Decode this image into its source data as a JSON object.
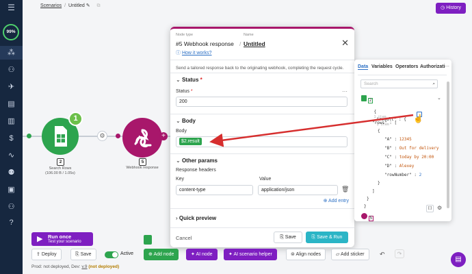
{
  "usage": "99%",
  "breadcrumb": {
    "root": "Scenarios",
    "separator": "/",
    "title": "Untitled"
  },
  "history_label": "History",
  "nodes": {
    "search_rows": {
      "number": "2",
      "label": "Search Rows",
      "sublabel": "(106.00 B / 1.05s)",
      "badge": "1",
      "color": "#2da44e"
    },
    "webhook_response": {
      "number": "5",
      "label": "Webhook response",
      "color": "#a8176b"
    }
  },
  "panel": {
    "node_type_caption": "Node type",
    "node_type": "#5 Webhook response",
    "name_caption": "Name",
    "name": "Untitled",
    "how_link": "How it works?",
    "description": "Send a tailored response back to the originating webhook, completing the request cycle.",
    "status_section": "Status",
    "required_mark": "*",
    "status_label": "Status",
    "status_value": "200",
    "body_section": "Body",
    "body_label": "Body",
    "body_chip": "$2.result",
    "other_params_section": "Other params",
    "response_headers_label": "Response headers",
    "key_header": "Key",
    "value_header": "Value",
    "key_value": "content-type",
    "value_value": "application/json",
    "add_entry": "Add entry",
    "quick_preview_section": "Quick preview",
    "cancel_label": "Cancel",
    "save_label": "Save",
    "save_run_label": "Save & Run"
  },
  "data_panel": {
    "tabs": [
      "Data",
      "Variables",
      "Operators",
      "Authorizati"
    ],
    "search_placeholder": "Search",
    "source_number": "2",
    "items_count": "1 item",
    "items_count_2": "1 item",
    "tree": {
      "open_brace": "{",
      "result_key": "\"result\"",
      "rows_key": "\"rows\"",
      "row_open": "{",
      "row_close": "}",
      "fields": [
        {
          "key": "\"A\"",
          "value": "12345"
        },
        {
          "key": "\"B\"",
          "value": "Out for delivery"
        },
        {
          "key": "\"C\"",
          "value": "today by 20:00"
        },
        {
          "key": "\"D\"",
          "value": "Alexey"
        },
        {
          "key": "\"rowNumber\"",
          "value": "2"
        }
      ],
      "close_bracket": "]",
      "close_brace": "}",
      "close_root": "}"
    },
    "footer_number": "5"
  },
  "bottom": {
    "run_once_label": "Run once",
    "run_once_sub": "Test your scenario",
    "deploy_label": "Deploy",
    "save_label": "Save",
    "active_label": "Active",
    "add_node_label": "Add node",
    "ai_node_label": "AI node",
    "ai_helper_label": "AI scenario helper",
    "align_label": "Align nodes",
    "sticker_label": "Add sticker",
    "prod_text": "Prod: not deployed, Dev: ",
    "dev_version": "v.9",
    "dev_status": "(not deployed)"
  },
  "colors": {
    "accent": "#7e1fc1",
    "sidebar": "#16273f",
    "sheets_green": "#2da44e",
    "webhook": "#a8176b",
    "arrow": "#d62e2e",
    "save_run": "#2bb5c6"
  }
}
